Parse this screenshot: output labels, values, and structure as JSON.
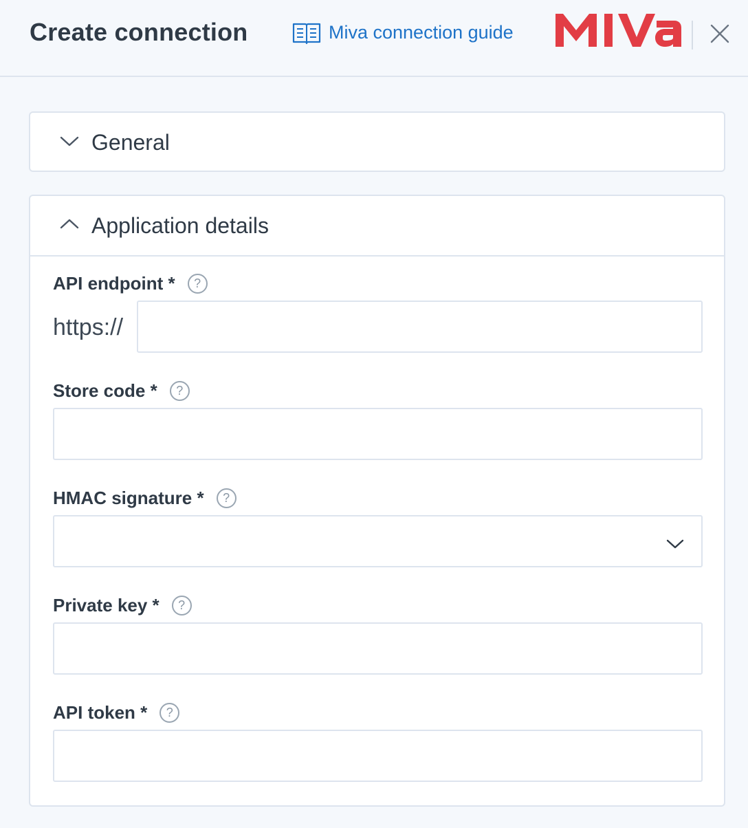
{
  "header": {
    "title": "Create connection",
    "guide_link": "Miva connection guide",
    "logo_text": "Miva",
    "icons": {
      "guide": "book-icon",
      "close": "close-icon"
    }
  },
  "panels": {
    "general": {
      "title": "General",
      "expanded": false
    },
    "app": {
      "title": "Application details",
      "expanded": true
    }
  },
  "fields": {
    "api_endpoint": {
      "label": "API endpoint *",
      "prefix": "https://",
      "value": ""
    },
    "store_code": {
      "label": "Store code *",
      "value": ""
    },
    "hmac_signature": {
      "label": "HMAC signature *",
      "value": ""
    },
    "private_key": {
      "label": "Private key *",
      "value": ""
    },
    "api_token": {
      "label": "API token *",
      "value": ""
    }
  },
  "colors": {
    "link": "#1e73c8",
    "logo": "#e23d45",
    "border": "#dde4ee",
    "background": "#f5f8fc"
  }
}
